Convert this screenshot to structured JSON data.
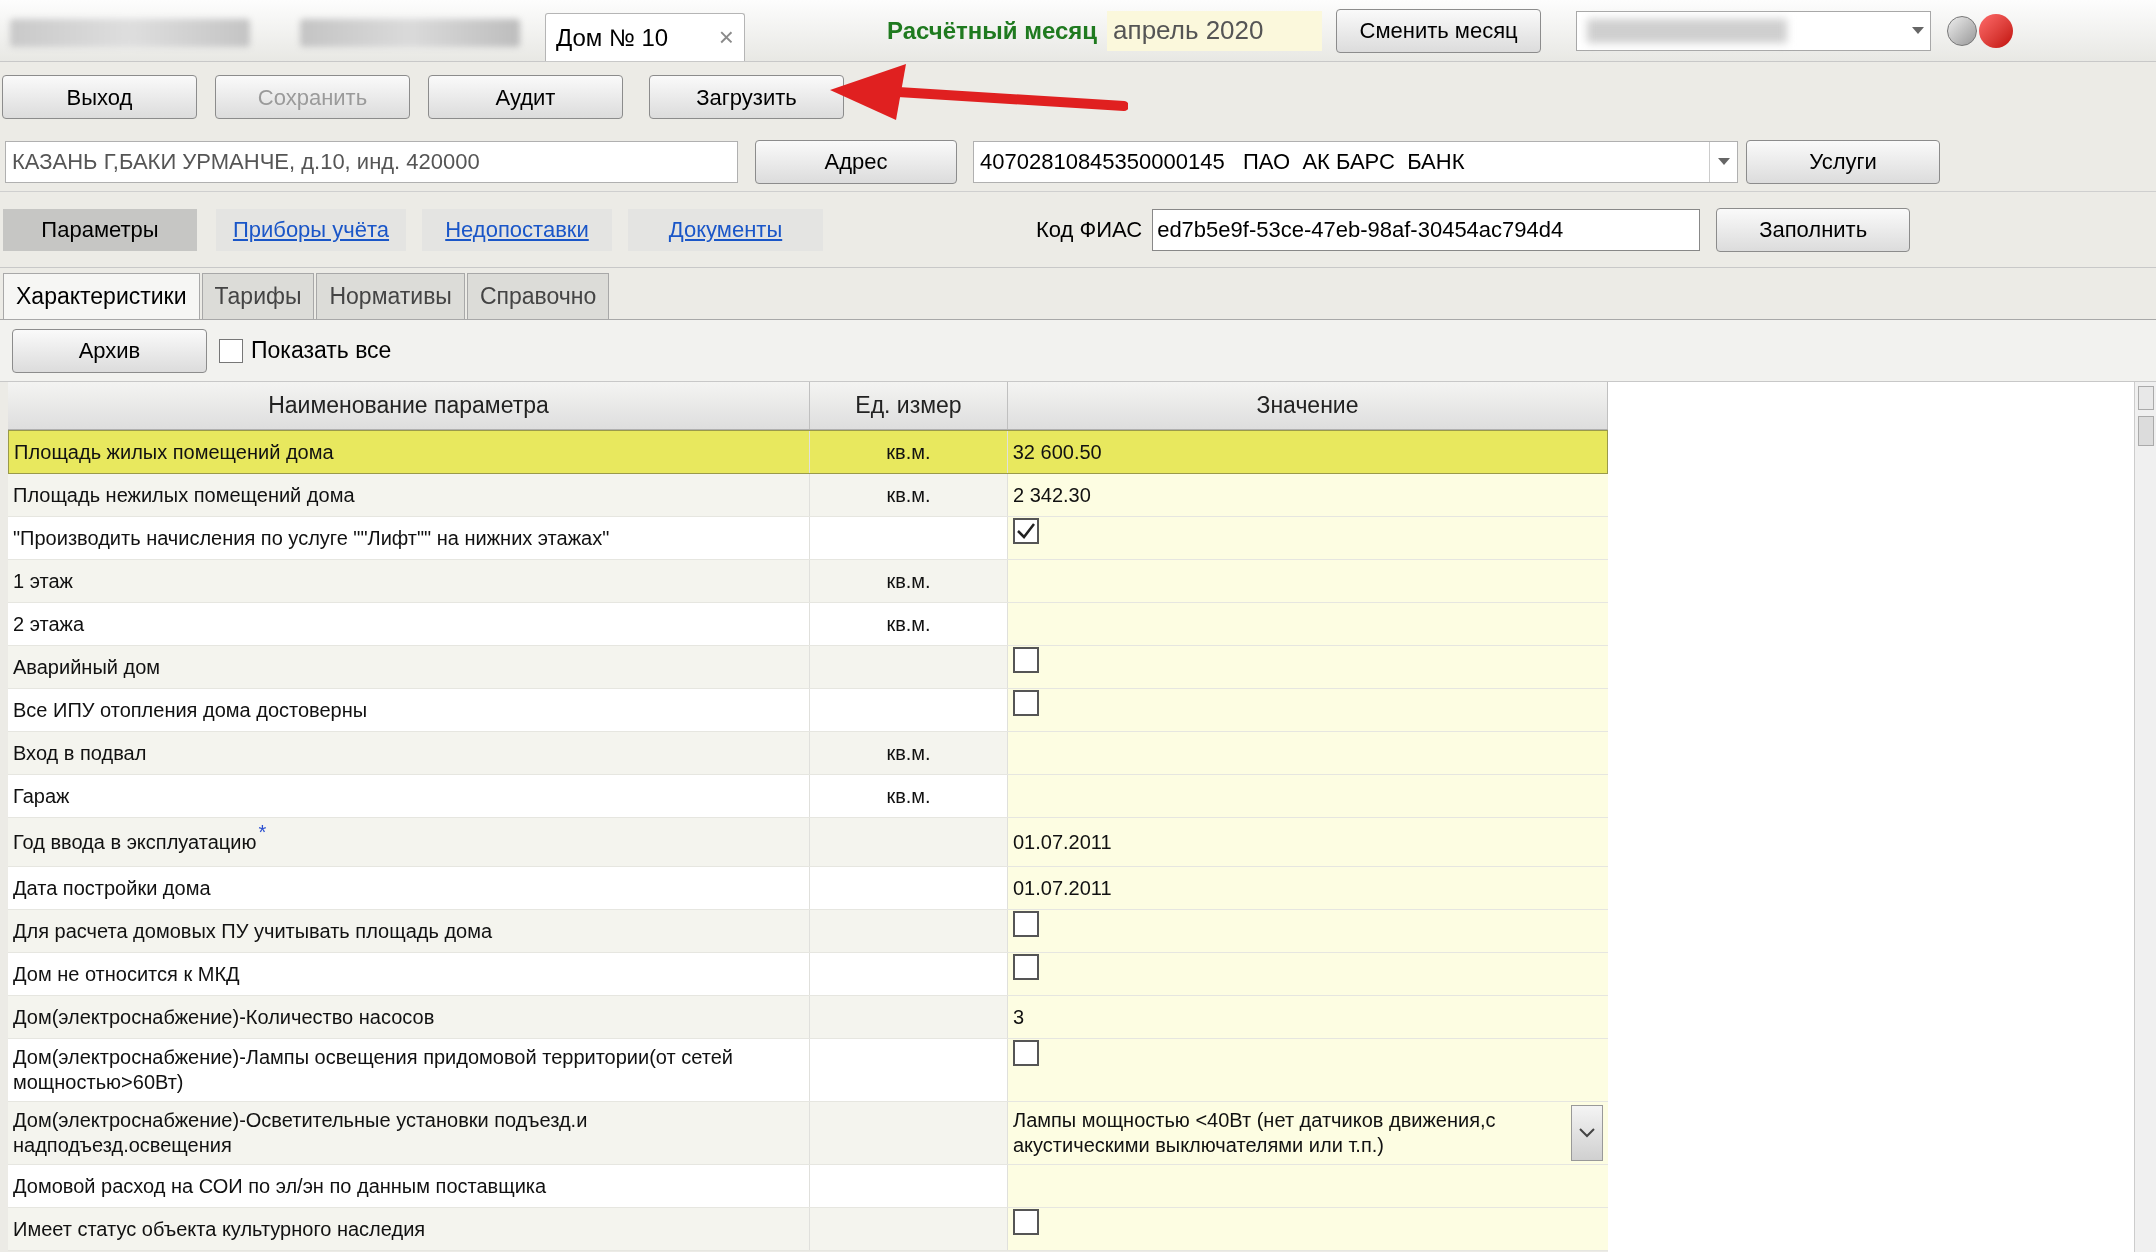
{
  "top_bar": {
    "tabs": [
      {
        "label": "Дом № 10",
        "close": "×",
        "selected": true
      }
    ],
    "month_label": "Расчётный месяц",
    "month_value": "апрель 2020",
    "change_month_button": "Сменить месяц"
  },
  "toolbar": {
    "buttons": [
      {
        "label": "Выход",
        "disabled": false
      },
      {
        "label": "Сохранить",
        "disabled": true
      },
      {
        "label": "Аудит",
        "disabled": false
      },
      {
        "label": "Загрузить",
        "disabled": false
      }
    ]
  },
  "address_row": {
    "address": "КАЗАНЬ Г,БАКИ УРМАНЧЕ, д.10, инд. 420000",
    "address_button": "Адрес",
    "account": "40702810845350000145   ПАО  АК БАРС  БАНК",
    "services_button": "Услуги"
  },
  "section_nav": [
    {
      "label": "Параметры",
      "selected": true
    },
    {
      "label": "Приборы учёта",
      "selected": false
    },
    {
      "label": "Недопоставки",
      "selected": false
    },
    {
      "label": "Документы",
      "selected": false
    }
  ],
  "fias": {
    "label": "Код ФИАС",
    "value": "ed7b5e9f-53ce-47eb-98af-30454ac794d4",
    "fill_button": "Заполнить"
  },
  "tabs": [
    {
      "label": "Характеристики",
      "selected": true
    },
    {
      "label": "Тарифы",
      "selected": false
    },
    {
      "label": "Нормативы",
      "selected": false
    },
    {
      "label": "Справочно",
      "selected": false
    }
  ],
  "archive_button": {
    "label": "Архив"
  },
  "show_all": {
    "label": "Показать все",
    "checked": false
  },
  "table": {
    "columns": [
      "Наименование параметра",
      "Ед. измер",
      "Значение"
    ],
    "rows": [
      {
        "name": "Площадь жилых помещений дома",
        "unit": "кв.м.",
        "kind": "text",
        "value": "32 600.50",
        "selected": true
      },
      {
        "name": "Площадь нежилых помещений дома",
        "unit": "кв.м.",
        "kind": "text",
        "value": "2 342.30",
        "selected": false
      },
      {
        "name": "\"Производить начисления по услуге \"\"Лифт\"\" на нижних этажах\"",
        "kind": "checkbox",
        "checked": true,
        "selected": false
      },
      {
        "name": "1 этаж",
        "unit": "кв.м.",
        "kind": "text",
        "selected": false
      },
      {
        "name": "2 этажа",
        "unit": "кв.м.",
        "kind": "text",
        "selected": false
      },
      {
        "name": "Аварийный дом",
        "kind": "checkbox",
        "checked": false,
        "selected": false
      },
      {
        "name": "Все ИПУ отопления дома достоверны",
        "kind": "checkbox",
        "checked": false,
        "selected": false
      },
      {
        "name": "Вход в подвал",
        "unit": "кв.м.",
        "kind": "text",
        "selected": false
      },
      {
        "name": "Гараж",
        "unit": "кв.м.",
        "kind": "text",
        "selected": false
      },
      {
        "name": "Год ввода в эксплуатацию",
        "mark": "*",
        "kind": "text",
        "value": "01.07.2011",
        "selected": false
      },
      {
        "name": "Дата постройки дома",
        "kind": "text",
        "value": "01.07.2011",
        "selected": false
      },
      {
        "name": "Для расчета домовых ПУ учитывать площадь дома",
        "kind": "checkbox",
        "checked": false,
        "selected": false
      },
      {
        "name": "Дом не относится к МКД",
        "kind": "checkbox",
        "checked": false,
        "selected": false
      },
      {
        "name": "Дом(электроснабжение)-Количество насосов",
        "kind": "text",
        "value": "3",
        "selected": false
      },
      {
        "name": "Дом(электроснабжение)-Лампы освещения придомовой территории(от сетей мощностью>60Вт)",
        "kind": "checkbox",
        "checked": false,
        "selected": false
      },
      {
        "name": "Дом(электроснабжение)-Осветительные установки подъезд.и надподъезд.освещения",
        "kind": "dropdown",
        "value": "Лампы мощностью <40Вт (нет датчиков движения,с акустическими выключателями или т.п.)",
        "selected": false
      },
      {
        "name": "Домовой расход на СОИ по эл/эн по данным поставщика",
        "kind": "text",
        "selected": false
      },
      {
        "name": "Имеет статус объекта культурного наследия",
        "kind": "checkbox",
        "checked": false,
        "selected": false
      }
    ]
  }
}
